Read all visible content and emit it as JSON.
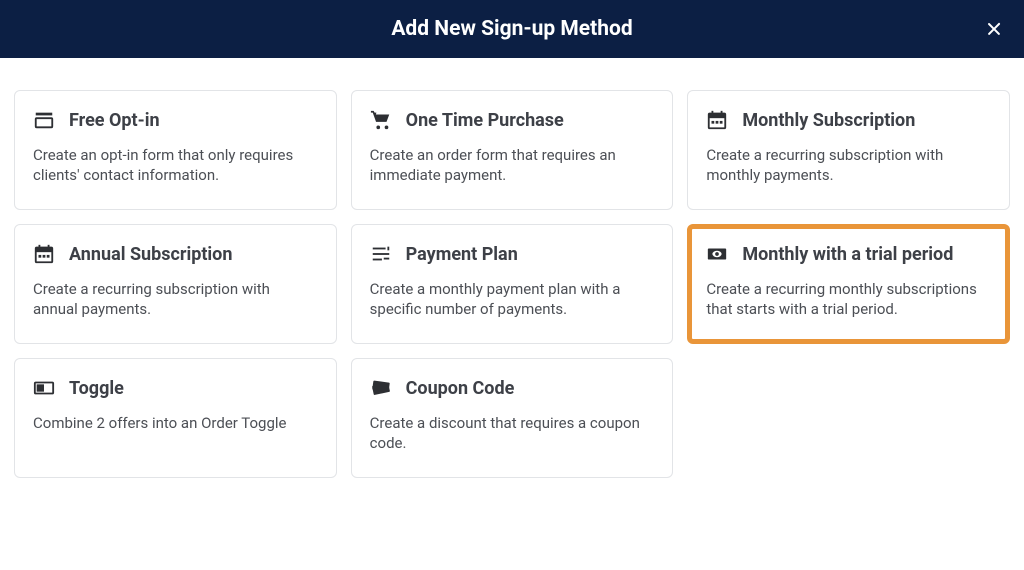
{
  "header": {
    "title": "Add New Sign-up Method"
  },
  "cards": [
    {
      "title": "Free Opt-in",
      "desc": "Create an opt-in form that only requires clients' contact information.",
      "highlighted": false
    },
    {
      "title": "One Time Purchase",
      "desc": "Create an order form that requires an immediate payment.",
      "highlighted": false
    },
    {
      "title": "Monthly Subscription",
      "desc": "Create a recurring subscription with monthly payments.",
      "highlighted": false
    },
    {
      "title": "Annual Subscription",
      "desc": "Create a recurring subscription with annual payments.",
      "highlighted": false
    },
    {
      "title": "Payment Plan",
      "desc": "Create a monthly payment plan with a specific number of payments.",
      "highlighted": false
    },
    {
      "title": "Monthly with a trial period",
      "desc": "Create a recurring monthly subscriptions that starts with a trial period.",
      "highlighted": true
    },
    {
      "title": "Toggle",
      "desc": "Combine 2 offers into an Order Toggle",
      "highlighted": false
    },
    {
      "title": "Coupon Code",
      "desc": "Create a discount that requires a coupon code.",
      "highlighted": false
    }
  ]
}
